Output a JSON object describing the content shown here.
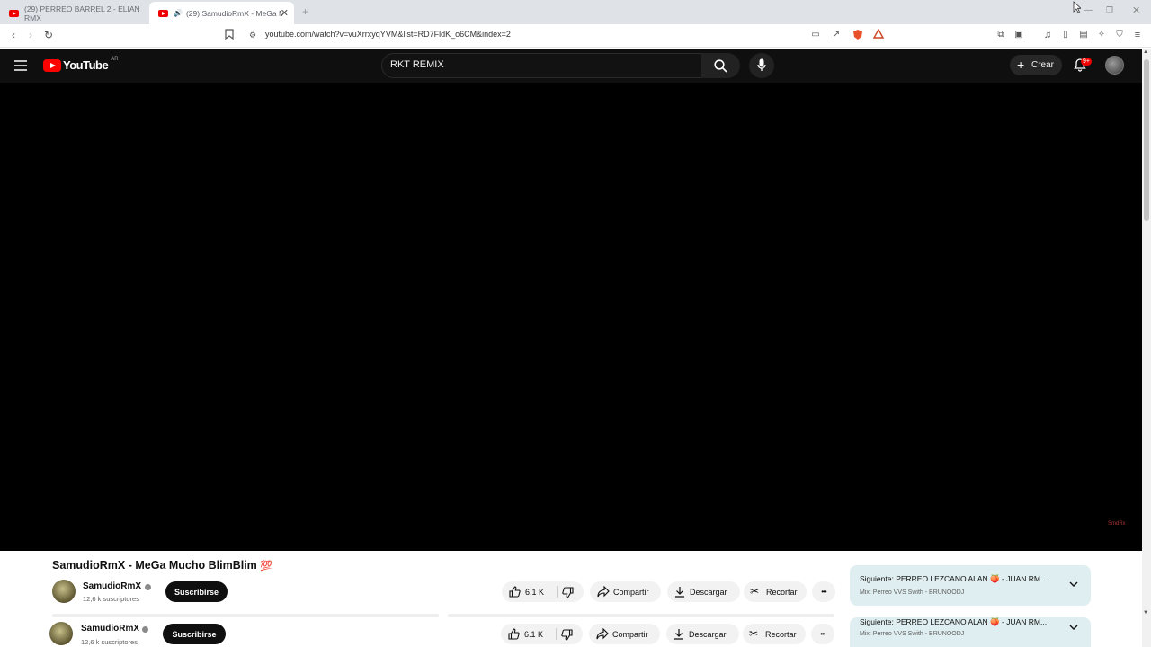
{
  "browser": {
    "tabs": [
      {
        "title": "(29) PERREO BARREL 2 - ELIAN RMX",
        "active": false
      },
      {
        "title": "(29) SamudioRmX - MeGa M",
        "active": true
      }
    ],
    "new_tab_label": "+",
    "url": "youtube.com/watch?v=vuXrrxyqYVM&list=RD7FldK_o6CM&index=2"
  },
  "youtube": {
    "logo_text": "YouTube",
    "region": "AR",
    "search_query": "RKT REMIX",
    "create_label": "Crear",
    "notifications_badge": "9+",
    "player_watermark": "SmdRx"
  },
  "video": {
    "title": "SamudioRmX - MeGa Mucho BlimBlim",
    "title_emoji": "💯",
    "channel_name": "SamudioRmX",
    "subscribers": "12,6 k suscriptores",
    "subscribe_label": "Suscribirse",
    "likes": "6.1 K",
    "share_label": "Compartir",
    "download_label": "Descargar",
    "clip_label": "Recortar",
    "more_label": "•••"
  },
  "up_next": {
    "label": "Siguiente:",
    "title": "PERREO LEZCANO ALAN 🍑 - JUAN RM...",
    "subtitle": "Mix: Perreo VVS Swith - BRUNOODJ"
  },
  "colors": {
    "youtube_red": "#FF0000",
    "header_bg": "#0f0f0f",
    "up_next_bg": "#dfeef0"
  }
}
